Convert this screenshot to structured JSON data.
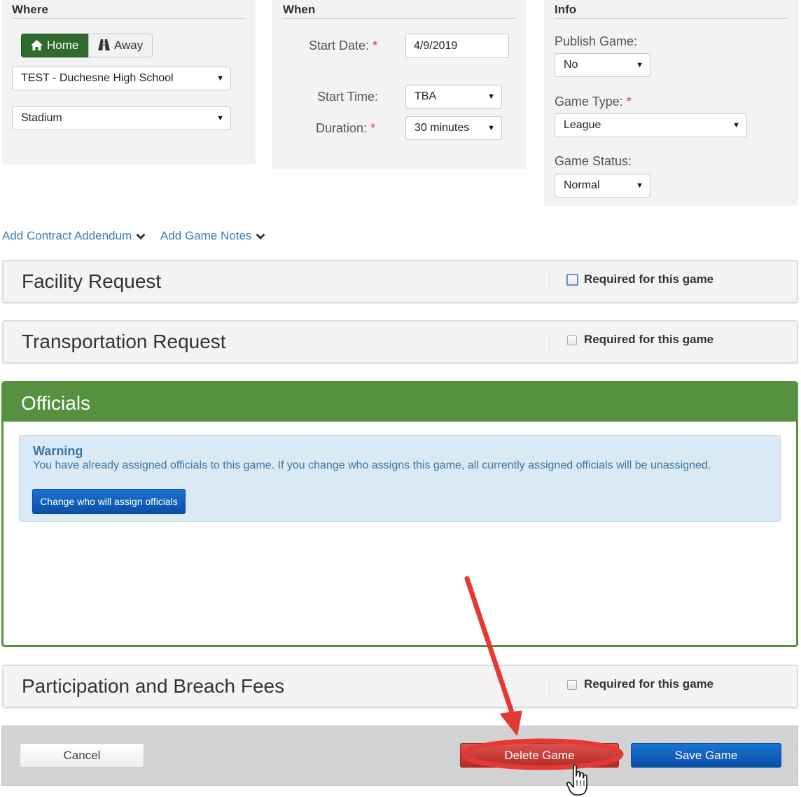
{
  "where": {
    "title": "Where",
    "home_label": "Home",
    "away_label": "Away",
    "school_value": "TEST - Duchesne High School",
    "venue_value": "Stadium"
  },
  "when": {
    "title": "When",
    "start_date_label": "Start Date:",
    "start_date_value": "4/9/2019",
    "start_time_label": "Start Time:",
    "start_time_value": "TBA",
    "duration_label": "Duration:",
    "duration_value": "30 minutes",
    "required_mark": "*"
  },
  "info": {
    "title": "Info",
    "publish_label": "Publish Game:",
    "publish_value": "No",
    "game_type_label": "Game Type:",
    "game_type_value": "League",
    "game_status_label": "Game Status:",
    "game_status_value": "Normal",
    "required_mark": "*"
  },
  "links": {
    "contract_addendum": "Add Contract Addendum",
    "game_notes": "Add Game Notes"
  },
  "sections": {
    "facility_title": "Facility Request",
    "transportation_title": "Transportation Request",
    "fees_title": "Participation and Breach Fees",
    "required_label": "Required for this game"
  },
  "officials": {
    "title": "Officials",
    "warning_title": "Warning",
    "warning_text": "You have already assigned officials to this game. If you change who assigns this game, all currently assigned officials will be unassigned.",
    "change_button": "Change who will assign officials"
  },
  "footer": {
    "cancel_label": "Cancel",
    "delete_label": "Delete Game",
    "save_label": "Save Game"
  },
  "colors": {
    "home_active": "#2f6b2f",
    "officials_header": "#55913f",
    "delete": "#c9302c",
    "save": "#0b5fbf",
    "annotation": "#e53935",
    "link": "#3a7fb6"
  }
}
